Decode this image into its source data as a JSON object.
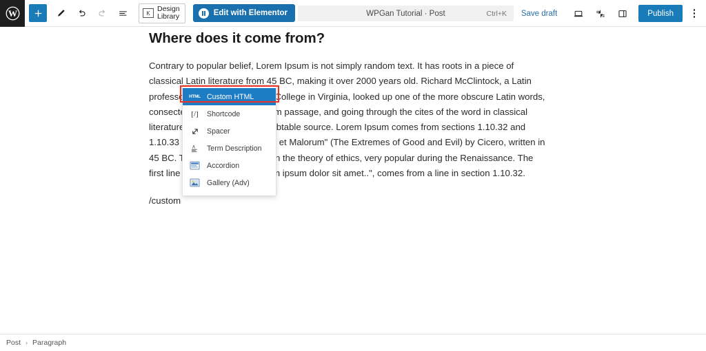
{
  "app": {
    "name": "WordPress Block Editor"
  },
  "toolbar": {
    "logo_icon": "wordpress-logo-icon",
    "add_block_label": "+",
    "add_block_icon": "plus-icon",
    "tools_icon": "pencil-edit-icon",
    "undo_icon": "undo-arrow-icon",
    "redo_icon": "redo-arrow-icon",
    "list_view_icon": "list-view-icon",
    "design_library": {
      "line1": "Design",
      "line2": "Library",
      "icon": "design-library-icon"
    },
    "elementor_button": {
      "label": "Edit with Elementor",
      "icon": "elementor-logo-icon"
    },
    "command_bar": {
      "title": "WPGan Tutorial · Post",
      "shortcut": "Ctrl+K"
    },
    "save_draft_label": "Save draft",
    "preview_icon": "preview-monitor-icon",
    "jetpack_icon": "jetpack-icon",
    "settings_sidebar_icon": "sidebar-panel-icon",
    "publish_label": "Publish",
    "options_icon": "kebab-menu-icon"
  },
  "document": {
    "heading": "Where does it come from?",
    "paragraph1": "Contrary to popular belief, Lorem Ipsum is not simply random text. It has roots in a piece of classical Latin literature from 45 BC, making it over 2000 years old. Richard McClintock, a Latin professor at Hampden-Sydney College in Virginia, looked up one of the more obscure Latin words, consectetur, from a Lorem Ipsum passage, and going through the cites of the word in classical literature, discovered the undoubtable source. Lorem Ipsum comes from sections 1.10.32 and 1.10.33 of \"de Finibus Bonorum et Malorum\" (The Extremes of Good and Evil) by Cicero, written in 45 BC. This book is a treatise on the theory of ethics, very popular during the Renaissance. The first line of Lorem Ipsum, \"Lorem ipsum dolor sit amet..\", comes from a line in section 1.10.32.",
    "slash_command": "/custom"
  },
  "slash_menu": {
    "items": [
      {
        "label": "Custom HTML",
        "icon": "html-code-icon",
        "icon_text": "HTML",
        "selected": true
      },
      {
        "label": "Shortcode",
        "icon": "shortcode-bracket-icon",
        "icon_text": "[/]",
        "selected": false
      },
      {
        "label": "Spacer",
        "icon": "spacer-resize-icon",
        "icon_text": "",
        "selected": false
      },
      {
        "label": "Term Description",
        "icon": "term-description-icon",
        "icon_text": "",
        "selected": false
      },
      {
        "label": "Accordion",
        "icon": "accordion-icon",
        "icon_text": "",
        "selected": false
      },
      {
        "label": "Gallery (Adv)",
        "icon": "gallery-image-icon",
        "icon_text": "",
        "selected": false
      }
    ]
  },
  "annotation": {
    "type": "red-highlight-rectangle",
    "color": "#ea3323",
    "targets": "Custom HTML"
  },
  "footer": {
    "breadcrumb": [
      "Post",
      "Paragraph"
    ],
    "separator": "›"
  },
  "colors": {
    "accent_blue": "#1a7bb9",
    "elementor_blue": "#1a6fad",
    "menu_highlight": "#1d7cc4",
    "annotation_red": "#ea3323",
    "link_blue": "#2a6fa8"
  }
}
